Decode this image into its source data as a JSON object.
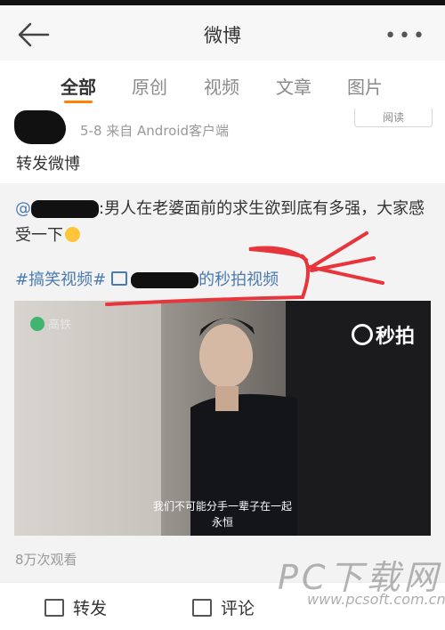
{
  "header": {
    "title": "微博",
    "back_icon": "back-arrow-icon",
    "more_icon": "more-dots-icon",
    "more_label": "•••"
  },
  "tabs": [
    {
      "label": "全部",
      "active": true
    },
    {
      "label": "原创"
    },
    {
      "label": "视频"
    },
    {
      "label": "文章"
    },
    {
      "label": "图片"
    }
  ],
  "post": {
    "meta": "5-8  来自 Android客户端",
    "read_button": "阅读",
    "text": "转发微博"
  },
  "repost": {
    "mention_prefix": "@",
    "body_suffix": ":男人在老婆面前的求生欲到底有多强，大家感受一下",
    "topic": "#搞笑视频#",
    "video_link_suffix": "的秒拍视频",
    "views": "8万次观看"
  },
  "video": {
    "left_logo": "高铁",
    "right_logo": "秒拍",
    "subtitle_line1": "我们不可能分手一辈子在一起",
    "subtitle_line2": "永恒"
  },
  "footer": {
    "repost_label": "转发",
    "comment_label": "评论"
  },
  "watermark": {
    "big": "PC下载网",
    "url": "www.pcsoft.com.cn"
  },
  "colors": {
    "accent": "#ff8200",
    "link": "#4a7bb0",
    "annotation": "#e8353b"
  }
}
